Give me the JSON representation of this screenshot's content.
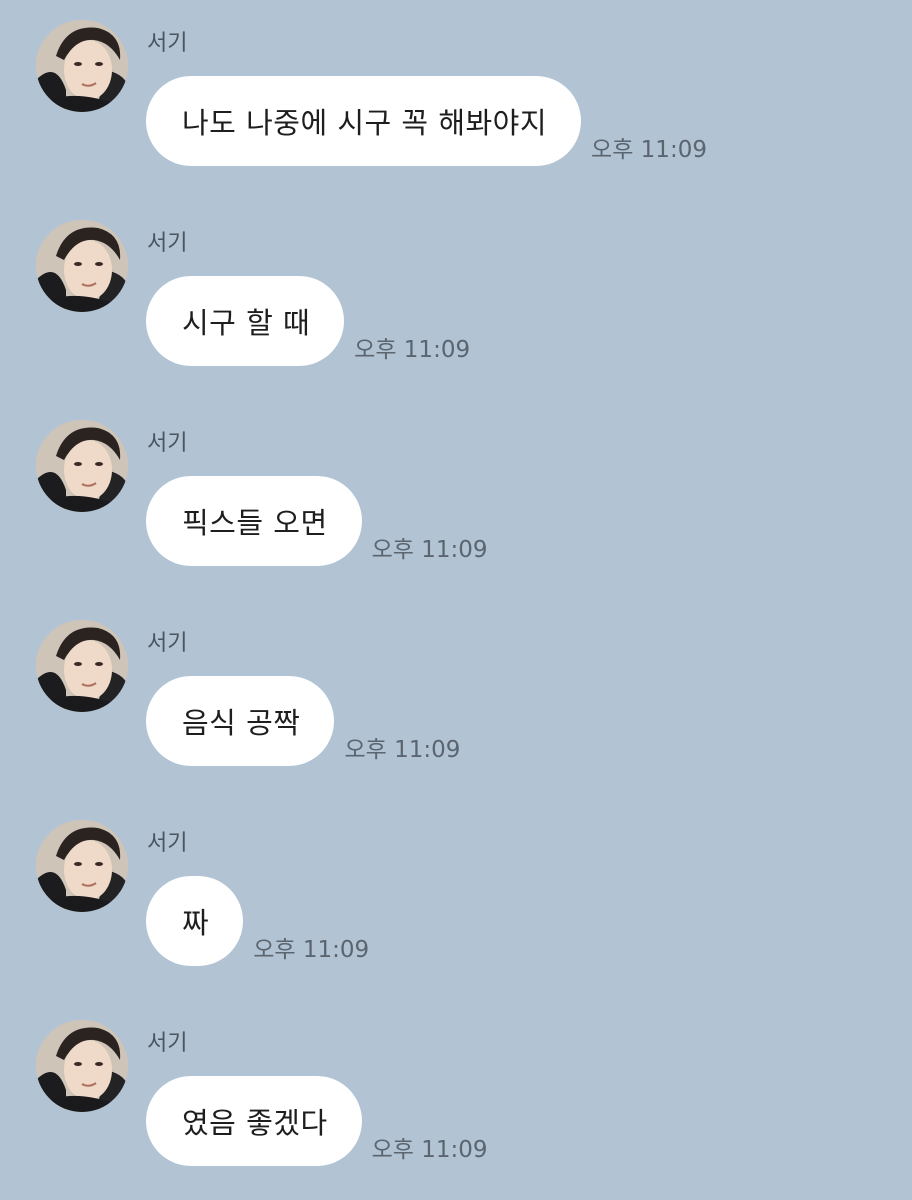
{
  "chat": {
    "messages": [
      {
        "sender": "서기",
        "text": "나도 나중에 시구 꼭 해봐야지",
        "time": "오후 11:09"
      },
      {
        "sender": "서기",
        "text": "시구 할 때",
        "time": "오후 11:09"
      },
      {
        "sender": "서기",
        "text": "픽스들 오면",
        "time": "오후 11:09"
      },
      {
        "sender": "서기",
        "text": "음식 공짝",
        "time": "오후 11:09"
      },
      {
        "sender": "서기",
        "text": "짜",
        "time": "오후 11:09"
      },
      {
        "sender": "서기",
        "text": "였음 좋겠다",
        "time": "오후 11:09"
      }
    ]
  },
  "colors": {
    "background": "#b2c3d3",
    "bubble": "#ffffff",
    "text": "#1e1e1e",
    "meta_text": "#5a6570"
  },
  "icons": {
    "avatar": "profile-photo"
  }
}
